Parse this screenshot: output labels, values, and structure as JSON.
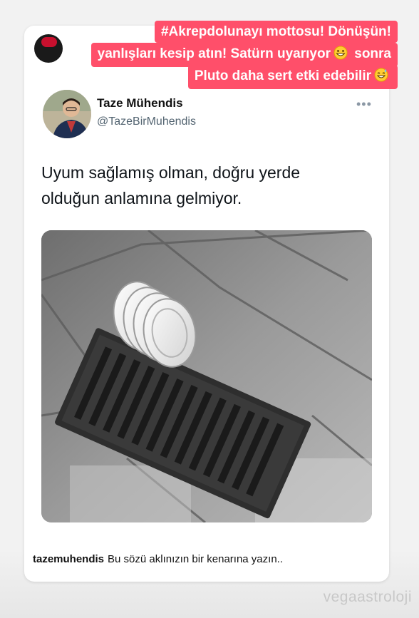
{
  "story": {
    "banner": {
      "line1_tag": "#Akrepdolunayı",
      "line1_rest": " mottosu! Dönüşün!",
      "line2_a": "yanlışları kesip atın! Satürn uyarıyor",
      "line2_b": " sonra",
      "line3": "Pluto daha sert etki edebilir",
      "emoji1": "grinning-face-emoji",
      "emoji2": "sweat-smile-emoji"
    },
    "watermark": "vegaastroloji"
  },
  "tweet": {
    "display_name": "Taze Mühendis",
    "handle": "@TazeBirMuhendis",
    "more": "•••",
    "text_line1": "Uyum sağlamış olman, doğru yerde",
    "text_line2": "olduğun anlamına gelmiyor.",
    "image": "dish-rack-plates-on-storm-drain-photo"
  },
  "post": {
    "username": "tazemuhendis",
    "caption": "Bu sözü aklınızın bir kenarına yazın.."
  },
  "colors": {
    "banner": "#ff4f6a",
    "handle_gray": "#536471"
  }
}
